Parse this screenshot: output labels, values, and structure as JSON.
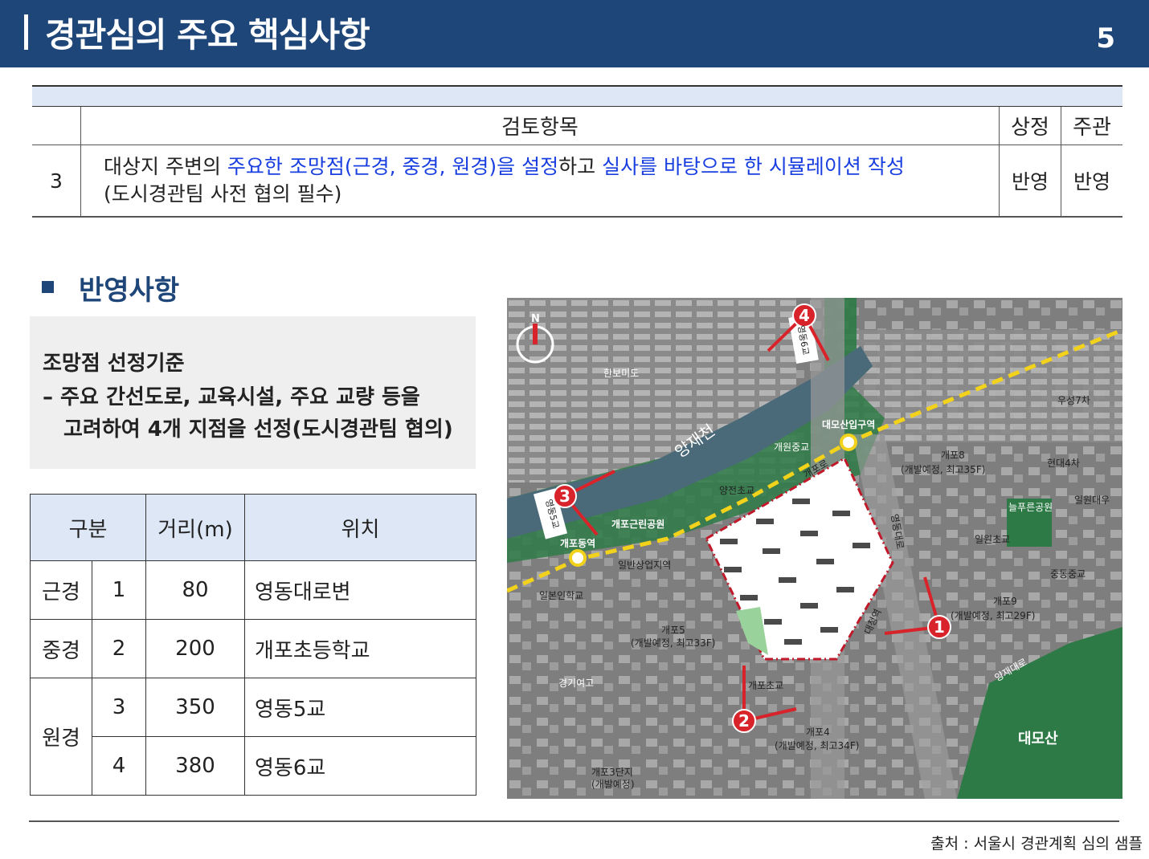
{
  "header": {
    "title": "경관심의 주요 핵심사항",
    "page_number": "5"
  },
  "review_table": {
    "headers": {
      "item": "검토항목",
      "col1": "상정",
      "col2": "주관"
    },
    "row": {
      "number": "3",
      "desc_parts": [
        "대상지 주변의 ",
        "주요한 조망점(근경, 중경, 원경)을 설정",
        "하고 ",
        "실사를 바탕으로 한 시뮬레이션 작성"
      ],
      "desc_line2": "(도시경관팀 사전 협의 필수)",
      "col1": "반영",
      "col2": "반영"
    }
  },
  "section": {
    "title": "반영사항"
  },
  "criteria": {
    "title": "조망점 선정기준",
    "line1": "– 주요 간선도로, 교육시설, 주요 교량 등을",
    "line2": "고려하여 4개 지점을 선정(도시경관팀 협의)"
  },
  "viewpoints": {
    "headers": [
      "구분",
      "거리(m)",
      "위치"
    ],
    "rows": [
      {
        "type": "근경",
        "no": "1",
        "distance": "80",
        "location": "영동대로변"
      },
      {
        "type": "중경",
        "no": "2",
        "distance": "200",
        "location": "개포초등학교"
      },
      {
        "type": "원경",
        "no": "3",
        "distance": "350",
        "location": "영동5교"
      },
      {
        "type": "",
        "no": "4",
        "distance": "380",
        "location": "영동6교"
      }
    ]
  },
  "map": {
    "labels": {
      "north": "N",
      "hanbo": "한보미도",
      "yangjae": "양재천",
      "daemosan_gu": "대모산입구역",
      "gaewon_ms": "개원중교",
      "gaepo8": "개포8",
      "gaepo8_sub": "(개발예정, 최고35F)",
      "woosung": "우성7차",
      "hyundai": "현대4차",
      "ilwon_daewoo": "일원대우",
      "green_park": "늘푸른공원",
      "yangjeon": "양전초교",
      "gaepo_park": "개포근린공원",
      "gaepo_station": "개포동역",
      "commercial": "일반상업지역",
      "ilwon_es": "일원초교",
      "japanese_school": "일본인학교",
      "gaepo9": "개포9",
      "gaepo9_sub": "(개발예정, 최고29F)",
      "jungdong": "중동중교",
      "gaepo5": "개포5",
      "gaepo5_sub": "(개발예정, 최고33F)",
      "kyunggi": "경기여고",
      "gaepo_es": "개포초교",
      "yangjae_daero": "양재대로",
      "daemosan": "대모산",
      "gaepo4": "개포4",
      "gaepo4_sub": "(개발예정, 최고34F)",
      "gaepo3": "개포3단지",
      "gaepo3_sub": "(개발예정)",
      "bridge5": "영동5교",
      "bridge6": "영동6교",
      "yeongdong_daero": "영동대로",
      "gaepo_ro": "개포로",
      "daechung": "대청역"
    },
    "markers": [
      "1",
      "2",
      "3",
      "4"
    ],
    "colors": {
      "marker": "#d8232a",
      "rail": "#f2d21b",
      "green": "#2e7a46",
      "river": "#4a6a7a"
    }
  },
  "source": "출처 : 서울시 경관계획 심의 샘플"
}
